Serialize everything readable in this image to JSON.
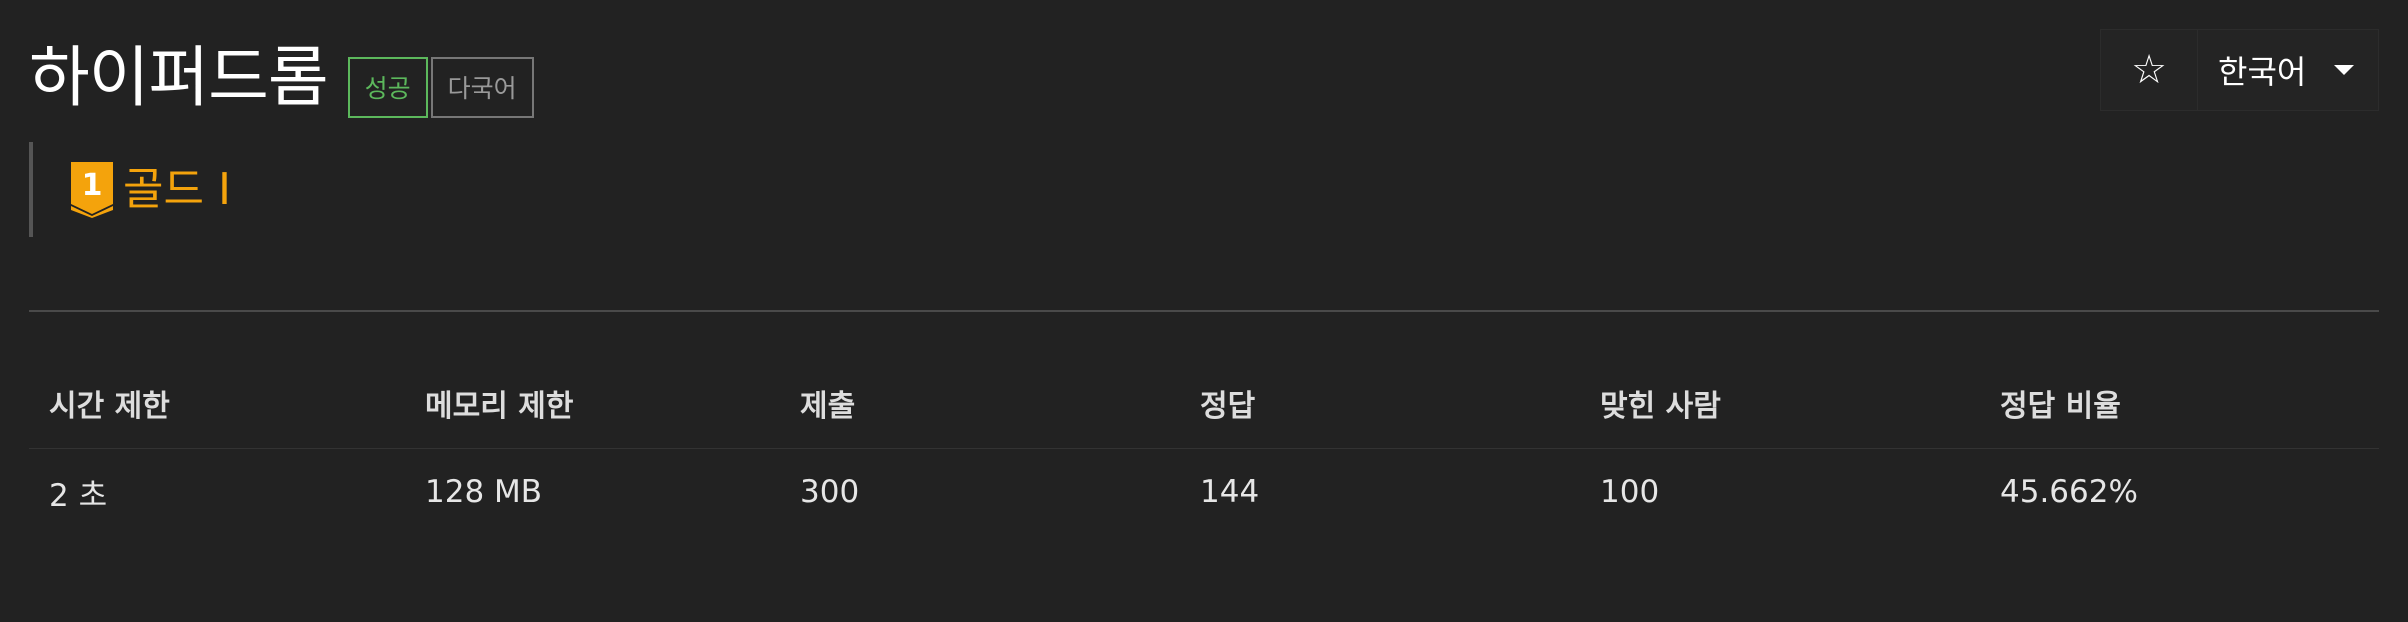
{
  "problem": {
    "title": "하이퍼드롬",
    "labels": {
      "success": "성공",
      "multilang": "다국어"
    }
  },
  "toolbar": {
    "star_icon": "star-icon",
    "star_glyph": "☆",
    "language": "한국어"
  },
  "tier": {
    "name": "골드 I",
    "level_digit": "1",
    "color": "#f4a30c"
  },
  "info_table": {
    "headers": [
      "시간 제한",
      "메모리 제한",
      "제출",
      "정답",
      "맞힌 사람",
      "정답 비율"
    ],
    "values": [
      "2 초",
      "128 MB",
      "300",
      "144",
      "100",
      "45.662%"
    ]
  },
  "colors": {
    "background": "#222222",
    "success": "#5cb85c",
    "tier_gold": "#f4a30c"
  }
}
